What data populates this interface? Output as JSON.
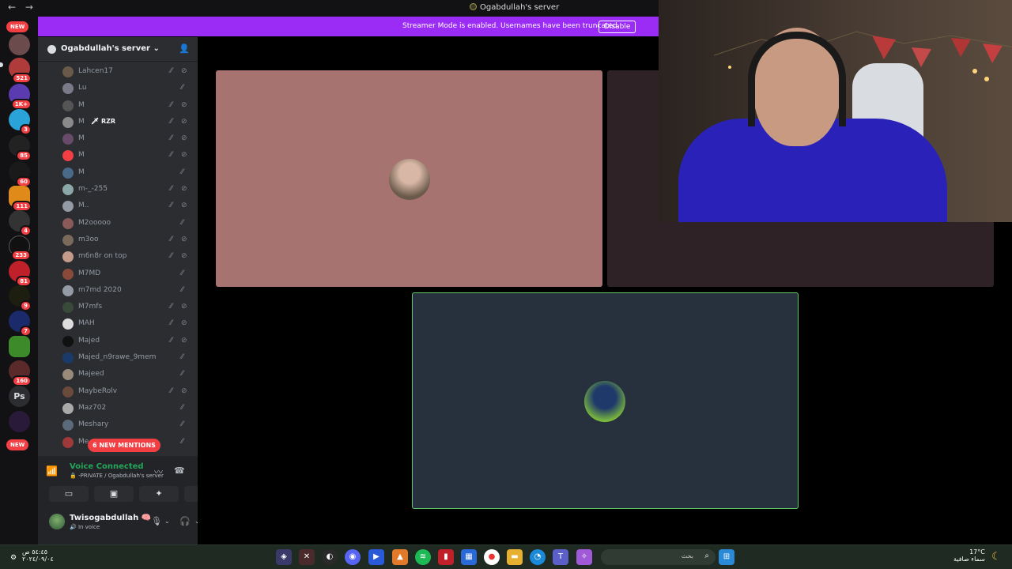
{
  "window": {
    "title": "Ogabdullah's server",
    "back": "←",
    "forward": "→"
  },
  "streamer_bar": {
    "message": "Streamer Mode is enabled. Usernames have been truncated.",
    "button": "Disable",
    "color": "#9b2cf5"
  },
  "rail": {
    "new_top": "NEW",
    "new_bottom": "NEW",
    "ps_label": "Ps",
    "badges": [
      "521",
      "1K+",
      "3",
      "85",
      "60",
      "111",
      "4",
      "233",
      "81",
      "9",
      "7",
      "160"
    ]
  },
  "server": {
    "name": "Ogabdullah's server ⌄",
    "invite_icon": "person-add-icon"
  },
  "members": [
    {
      "name": "Lahcen17",
      "deaf": true
    },
    {
      "name": "Lu",
      "deaf": false
    },
    {
      "name": "M",
      "deaf": true
    },
    {
      "name": "M",
      "tag": "🗡 RZR",
      "deaf": true
    },
    {
      "name": "M",
      "deaf": true
    },
    {
      "name": "M",
      "deaf": true
    },
    {
      "name": "M",
      "deaf": false
    },
    {
      "name": "m-_-255",
      "deaf": true
    },
    {
      "name": "M..",
      "deaf": true
    },
    {
      "name": "M2ooooo",
      "deaf": false
    },
    {
      "name": "m3oo",
      "deaf": true
    },
    {
      "name": "m6n8r on top",
      "deaf": true
    },
    {
      "name": "M7MD",
      "deaf": false
    },
    {
      "name": "m7md 2020",
      "deaf": false
    },
    {
      "name": "M7mfs",
      "deaf": true
    },
    {
      "name": "MAH",
      "deaf": true
    },
    {
      "name": "Majed",
      "deaf": true
    },
    {
      "name": "Majed_n9rawe_9mem",
      "deaf": false
    },
    {
      "name": "Majeed",
      "deaf": false
    },
    {
      "name": "MaybeRolv",
      "deaf": true
    },
    {
      "name": "Maz702",
      "deaf": false
    },
    {
      "name": "Meshary",
      "deaf": false
    },
    {
      "name": "Me",
      "deaf": false
    }
  ],
  "mentions": "6 NEW MENTIONS",
  "voice": {
    "status": "Voice Connected",
    "channel": "🔒 -PRIVATE / Ogabdullah's server"
  },
  "user": {
    "name": "Twisogabdullah 🧠",
    "status": "🔊 In voice"
  },
  "taskbar": {
    "search_placeholder": "بحث",
    "weather_temp": "17°C",
    "weather_desc": "سماء صافية",
    "clock_time": "٥٤:٤٥ ص",
    "clock_date": "٢٠٢٤/٠٩/٠٤"
  },
  "colors": {
    "tile_a": "#a67370",
    "tile_b": "#2f2226",
    "tile_c": "#27303d",
    "speaking_border": "#5ecc62",
    "voice_green": "#23a55a",
    "badge_red": "#f23f43"
  }
}
